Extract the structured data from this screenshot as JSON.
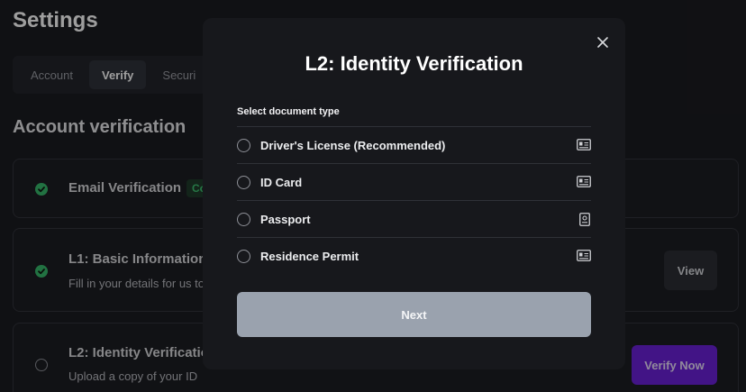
{
  "page": {
    "title": "Settings",
    "tabs": [
      {
        "label": "Account"
      },
      {
        "label": "Verify"
      },
      {
        "label": "Securi"
      }
    ],
    "section_title": "Account verification"
  },
  "cards": {
    "email": {
      "title": "Email Verification",
      "badge": "Co"
    },
    "l1": {
      "title": "L1: Basic Information",
      "subtitle": "Fill in your details for us to",
      "button": "View"
    },
    "l2": {
      "title": "L2: Identity Verificatio",
      "subtitle": "Upload a copy of your ID",
      "button": "Verify Now"
    }
  },
  "modal": {
    "title": "L2: Identity Verification",
    "close_icon": "close-icon",
    "doc_label": "Select document type",
    "documents": [
      {
        "name": "Driver's License (Recommended)",
        "icon": "id-card-icon"
      },
      {
        "name": "ID Card",
        "icon": "id-card-icon"
      },
      {
        "name": "Passport",
        "icon": "passport-icon"
      },
      {
        "name": "Residence Permit",
        "icon": "id-card-icon"
      }
    ],
    "next_button": "Next"
  },
  "colors": {
    "accent_purple": "#6b21d8",
    "success_green": "#37b86b",
    "next_disabled": "#9aa2ae"
  }
}
